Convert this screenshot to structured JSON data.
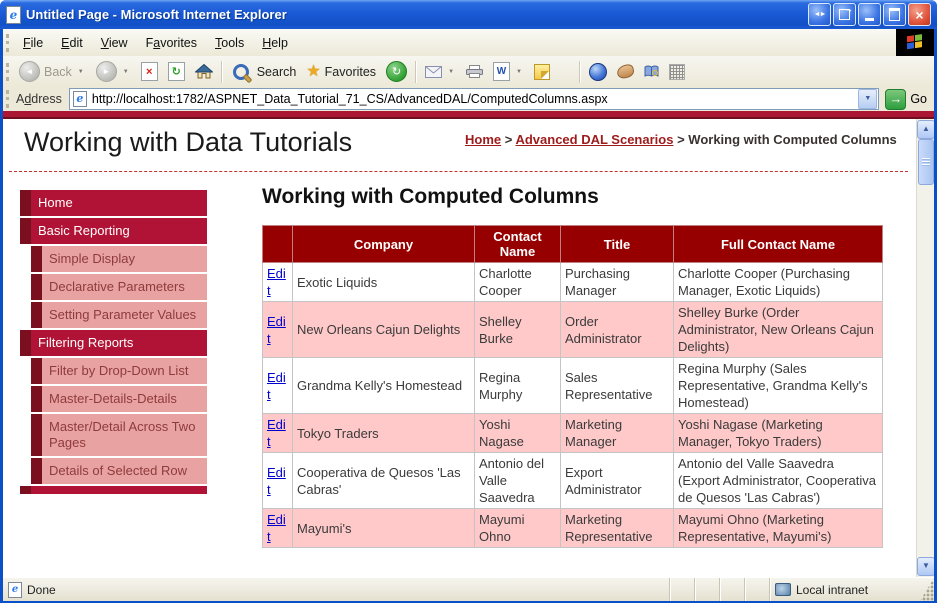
{
  "window": {
    "title": "Untitled Page - Microsoft Internet Explorer"
  },
  "menu": {
    "items": [
      {
        "label": "File",
        "accel": 0
      },
      {
        "label": "Edit",
        "accel": 0
      },
      {
        "label": "View",
        "accel": 0
      },
      {
        "label": "Favorites",
        "accel": 1
      },
      {
        "label": "Tools",
        "accel": 0
      },
      {
        "label": "Help",
        "accel": 0
      }
    ]
  },
  "toolbar": {
    "back_label": "Back",
    "search_label": "Search",
    "favorites_label": "Favorites"
  },
  "address": {
    "label": "Address",
    "accel": 1,
    "url": "http://localhost:1782/ASPNET_Data_Tutorial_71_CS/AdvancedDAL/ComputedColumns.aspx",
    "go_label": "Go"
  },
  "page": {
    "site_title": "Working with Data Tutorials",
    "breadcrumb": {
      "separator": ">",
      "parts": [
        {
          "text": "Home",
          "link": true
        },
        {
          "text": "Advanced DAL Scenarios",
          "link": true
        },
        {
          "text": "Working with Computed Columns",
          "link": false
        }
      ]
    },
    "heading": "Working with Computed Columns"
  },
  "sidebar": {
    "items": [
      {
        "label": "Home",
        "level": 1
      },
      {
        "label": "Basic Reporting",
        "level": 1
      },
      {
        "label": "Simple Display",
        "level": 2
      },
      {
        "label": "Declarative Parameters",
        "level": 2
      },
      {
        "label": "Setting Parameter Values",
        "level": 2
      },
      {
        "label": "Filtering Reports",
        "level": 1
      },
      {
        "label": "Filter by Drop-Down List",
        "level": 2
      },
      {
        "label": "Master-Details-Details",
        "level": 2
      },
      {
        "label": "Master/Detail Across Two Pages",
        "level": 2
      },
      {
        "label": "Details of Selected Row",
        "level": 2
      }
    ]
  },
  "table": {
    "edit_label": "Edit",
    "headers": [
      "",
      "Company",
      "Contact Name",
      "Title",
      "Full Contact Name"
    ],
    "rows": [
      {
        "company": "Exotic Liquids",
        "contact": "Charlotte Cooper",
        "title": "Purchasing Manager",
        "full": "Charlotte Cooper (Purchasing Manager, Exotic Liquids)"
      },
      {
        "company": "New Orleans Cajun Delights",
        "contact": "Shelley Burke",
        "title": "Order Administrator",
        "full": "Shelley Burke (Order Administrator, New Orleans Cajun Delights)"
      },
      {
        "company": "Grandma Kelly's Homestead",
        "contact": "Regina Murphy",
        "title": "Sales Representative",
        "full": "Regina Murphy (Sales Representative, Grandma Kelly's Homestead)"
      },
      {
        "company": "Tokyo Traders",
        "contact": "Yoshi Nagase",
        "title": "Marketing Manager",
        "full": "Yoshi Nagase (Marketing Manager, Tokyo Traders)"
      },
      {
        "company": "Cooperativa de Quesos 'Las Cabras'",
        "contact": "Antonio del Valle Saavedra",
        "title": "Export Administrator",
        "full": "Antonio del Valle Saavedra (Export Administrator, Cooperativa de Quesos 'Las Cabras')"
      },
      {
        "company": "Mayumi's",
        "contact": "Mayumi Ohno",
        "title": "Marketing Representative",
        "full": "Mayumi Ohno (Marketing Representative, Mayumi's)"
      }
    ]
  },
  "statusbar": {
    "status": "Done",
    "zone": "Local intranet"
  },
  "colors": {
    "crimson": "#B01335",
    "maroon_strip": "#7A0F1F",
    "submenu_pink": "#E9A2A2",
    "banner": "#AC1635",
    "header_red": "#970000",
    "row_pink": "#FFC9C9",
    "link_blue": "#0000CC",
    "breadcrumb_link": "#9E1B1B",
    "titlebar_blue": "#1A5AD6"
  }
}
